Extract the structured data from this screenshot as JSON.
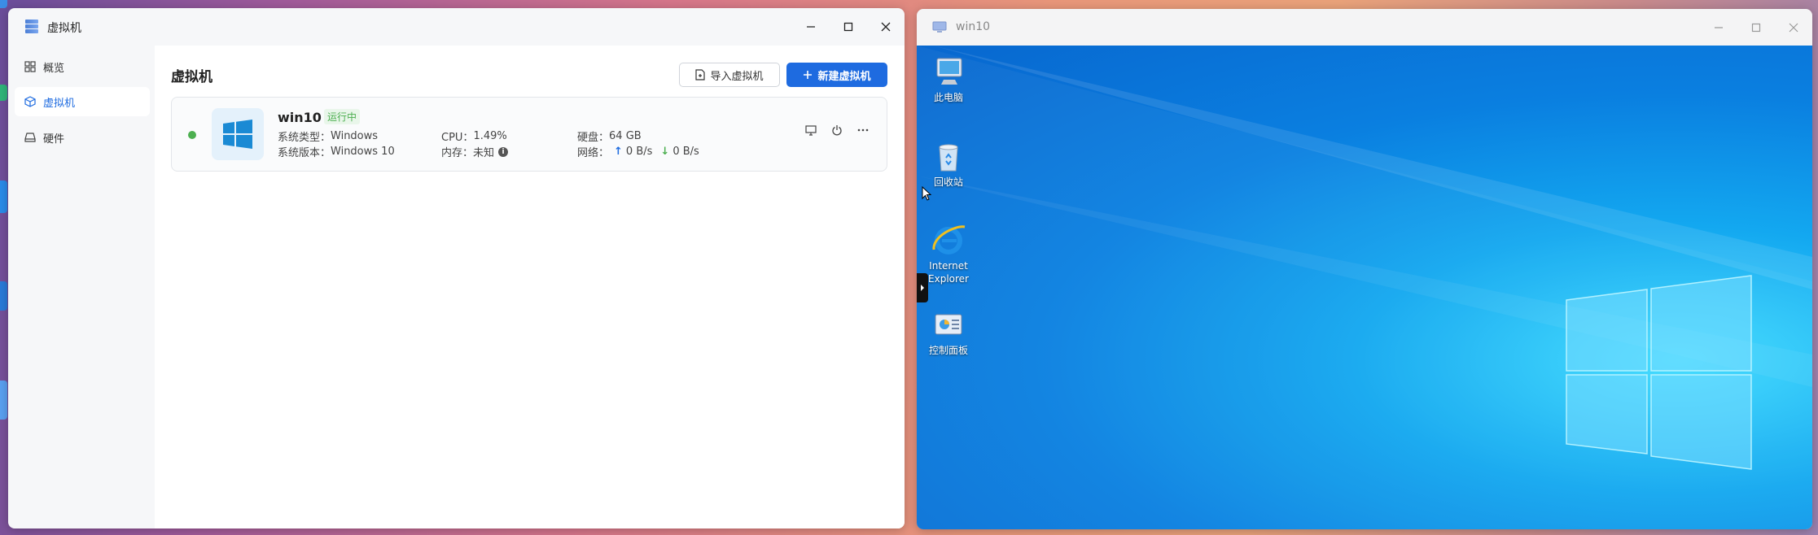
{
  "vm_manager": {
    "title": "虚拟机",
    "sidebar": {
      "items": [
        {
          "label": "概览",
          "icon": "grid-icon"
        },
        {
          "label": "虚拟机",
          "icon": "cube-icon"
        },
        {
          "label": "硬件",
          "icon": "drive-icon"
        }
      ]
    },
    "main": {
      "title": "虚拟机",
      "import_label": "导入虚拟机",
      "new_label": "新建虚拟机",
      "vm": {
        "name": "win10",
        "status": "运行中",
        "os_type_label": "系统类型：",
        "os_type": "Windows",
        "os_version_label": "系统版本：",
        "os_version": "Windows 10",
        "cpu_label": "CPU：",
        "cpu": "1.49%",
        "mem_label": "内存：",
        "mem": "未知",
        "disk_label": "硬盘：",
        "disk": "64 GB",
        "net_label": "网络：",
        "net_up": "0 B/s",
        "net_down": "0 B/s"
      }
    }
  },
  "vm_window": {
    "title": "win10",
    "desktop_icons": [
      {
        "label": "此电脑",
        "icon": "computer-icon"
      },
      {
        "label": "回收站",
        "icon": "recycle-bin-icon"
      },
      {
        "label": "Internet Explorer",
        "icon": "internet-explorer-icon"
      },
      {
        "label": "控制面板",
        "icon": "control-panel-icon"
      }
    ]
  },
  "colors": {
    "accent": "#1e6be0",
    "running": "#4caf50",
    "desktop": "#0a7fe0"
  }
}
